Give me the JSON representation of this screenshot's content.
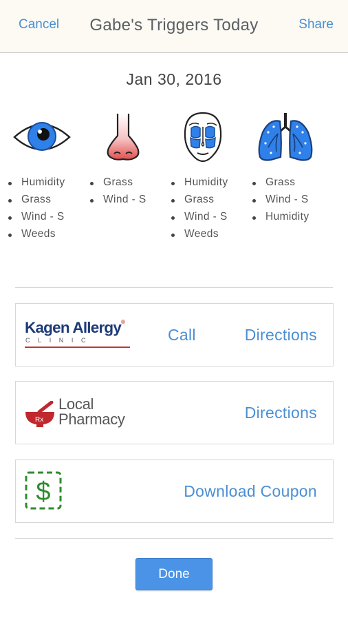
{
  "header": {
    "cancel_label": "Cancel",
    "title": "Gabe's Triggers Today",
    "share_label": "Share"
  },
  "date": "Jan 30, 2016",
  "organs": [
    {
      "icon": "eye-icon",
      "triggers": [
        "Humidity",
        "Grass",
        "Wind - S",
        "Weeds"
      ]
    },
    {
      "icon": "nose-icon",
      "triggers": [
        "Grass",
        "Wind - S"
      ]
    },
    {
      "icon": "sinus-face-icon",
      "triggers": [
        "Humidity",
        "Grass",
        "Wind - S",
        "Weeds"
      ]
    },
    {
      "icon": "lungs-icon",
      "triggers": [
        "Grass",
        "Wind - S",
        "Humidity"
      ]
    }
  ],
  "cards": {
    "clinic": {
      "logo_name": "Kagen Allergy",
      "logo_reg": "®",
      "logo_sub": "CLINIC",
      "call_label": "Call",
      "directions_label": "Directions"
    },
    "pharmacy": {
      "logo_line1": "Local",
      "logo_line2": "Pharmacy",
      "logo_rx": "Rx",
      "directions_label": "Directions"
    },
    "coupon": {
      "logo_symbol": "$",
      "download_label": "Download Coupon"
    }
  },
  "done_label": "Done",
  "colors": {
    "accent": "#4a8fd4",
    "header_bg": "#fcfaf3",
    "eye_blue": "#2f80e8",
    "nose_red": "#e25050",
    "coupon_green": "#2e8b2e",
    "pharmacy_red": "#c0282d",
    "done_button": "#4a93e6"
  }
}
